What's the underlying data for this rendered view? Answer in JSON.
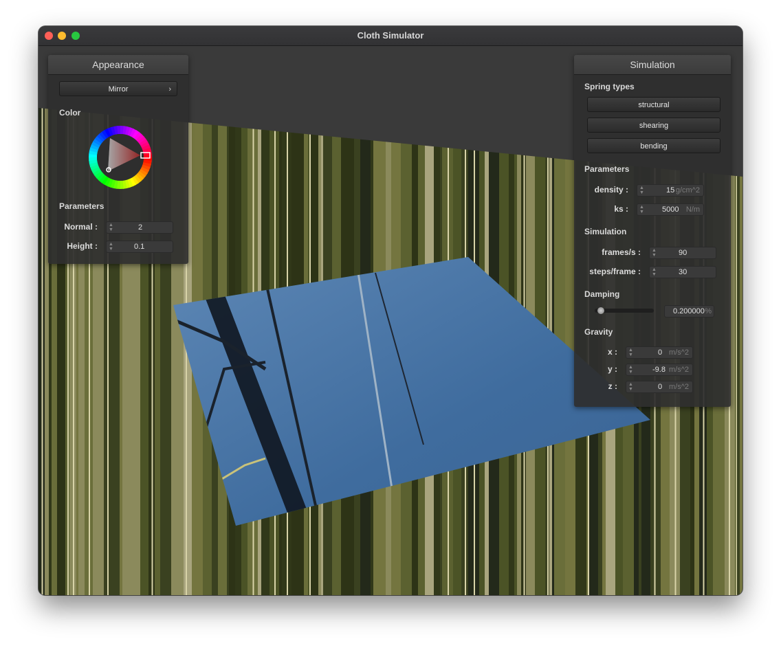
{
  "window": {
    "title": "Cloth Simulator"
  },
  "appearance": {
    "title": "Appearance",
    "shader_select": "Mirror",
    "color_label": "Color",
    "color_selected": "#e33a3a",
    "parameters_label": "Parameters",
    "normal": {
      "label": "Normal :",
      "value": "2"
    },
    "height": {
      "label": "Height :",
      "value": "0.1"
    }
  },
  "simulation": {
    "title": "Simulation",
    "spring_types_label": "Spring types",
    "springs": [
      "structural",
      "shearing",
      "bending"
    ],
    "parameters_label": "Parameters",
    "density": {
      "label": "density :",
      "value": "15",
      "unit": "g/cm^2"
    },
    "ks": {
      "label": "ks :",
      "value": "5000",
      "unit": "N/m"
    },
    "sim_label": "Simulation",
    "fps": {
      "label": "frames/s :",
      "value": "90"
    },
    "steps": {
      "label": "steps/frame :",
      "value": "30"
    },
    "damping_label": "Damping",
    "damping": {
      "value": "0.200000",
      "unit": "%",
      "level": 0.2
    },
    "gravity_label": "Gravity",
    "gx": {
      "label": "x :",
      "value": "0",
      "unit": "m/s^2"
    },
    "gy": {
      "label": "y :",
      "value": "-9.8",
      "unit": "m/s^2"
    },
    "gz": {
      "label": "z :",
      "value": "0",
      "unit": "m/s^2"
    }
  }
}
